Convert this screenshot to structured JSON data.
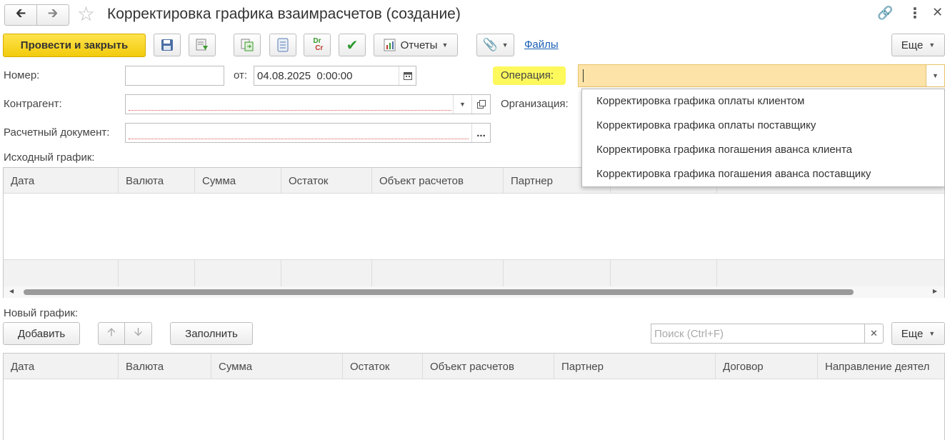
{
  "window": {
    "title": "Корректировка графика взаимрасчетов (создание)"
  },
  "toolbar": {
    "post_close_label": "Провести и закрыть",
    "reports_label": "Отчеты",
    "files_label": "Файлы",
    "more_label": "Еще"
  },
  "header_form": {
    "number_label": "Номер:",
    "number_value": "",
    "from_label": "от:",
    "date_value": "04.08.2025  0:00:00",
    "operation_label": "Операция:",
    "operation_value": "",
    "counterparty_label": "Контрагент:",
    "counterparty_value": "",
    "organization_label": "Организация:",
    "settlement_doc_label": "Расчетный документ:",
    "settlement_doc_value": ""
  },
  "operation_dropdown": {
    "options": [
      "Корректировка графика оплаты клиентом",
      "Корректировка графика оплаты поставщику",
      "Корректировка графика погашения аванса клиента",
      "Корректировка графика погашения аванса поставщику"
    ]
  },
  "original_schedule": {
    "title": "Исходный график:",
    "columns": [
      "Дата",
      "Валюта",
      "Сумма",
      "Остаток",
      "Объект расчетов",
      "Партнер"
    ]
  },
  "new_schedule": {
    "title": "Новый график:",
    "add_label": "Добавить",
    "fill_label": "Заполнить",
    "search_placeholder": "Поиск (Ctrl+F)",
    "more_label": "Еще",
    "columns": [
      "Дата",
      "Валюта",
      "Сумма",
      "Остаток",
      "Объект расчетов",
      "Партнер",
      "Договор",
      "Направление деятел"
    ]
  },
  "colors": {
    "accent_yellow": "#f5d21f",
    "operation_highlight": "#fdf74a",
    "operation_field_bg": "#fde3a7",
    "link_blue": "#1a5fb4"
  }
}
